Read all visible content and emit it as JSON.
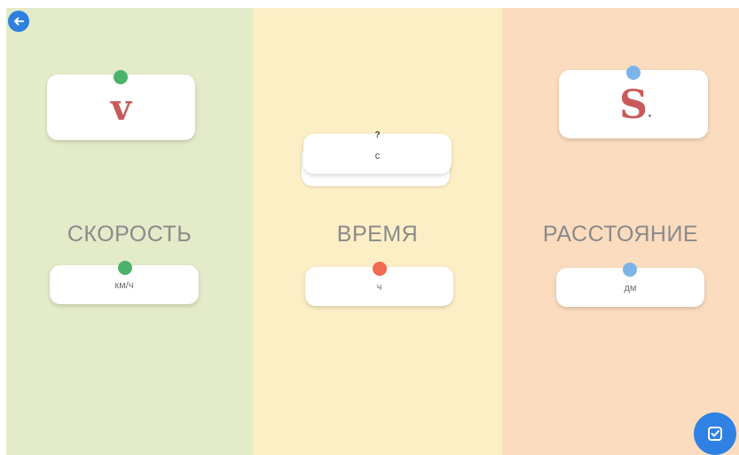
{
  "columns": {
    "speed": {
      "heading": "СКОРОСТЬ",
      "symbol": "v",
      "unit": "км/ч",
      "bg_color": "#e3ebc8",
      "symbol_dot_color": "#4cb26a",
      "unit_dot_color": "#4cb26a"
    },
    "time": {
      "heading": "ВРЕМЯ",
      "symbol_question": "?",
      "symbol": "с",
      "unit": "ч",
      "bg_color": "#fcefc6",
      "unit_dot_color": "#f26a4f"
    },
    "distance": {
      "heading": "РАССТОЯНИЕ",
      "symbol": "S",
      "unit": "дм",
      "bg_color": "#fbdcbf",
      "symbol_dot_color": "#7cb4e8",
      "unit_dot_color": "#7cb4e8"
    }
  },
  "controls": {
    "back_icon": "arrow-left-icon",
    "check_icon": "checkmark-icon",
    "accent_color": "#2f7fe0"
  }
}
